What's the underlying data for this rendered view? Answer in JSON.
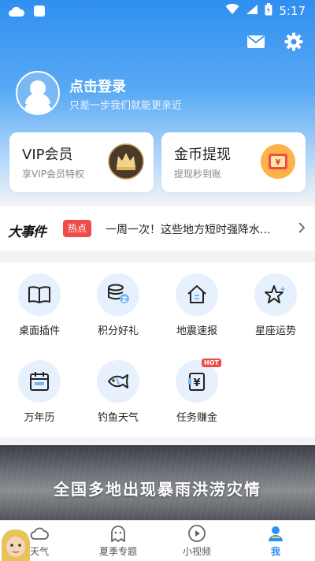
{
  "status_bar": {
    "time": "5:17"
  },
  "colors": {
    "brand": "#2f8ff0",
    "hot": "#ef4b4b",
    "icon_bg": "#e7f1fd"
  },
  "header": {
    "icons": [
      "mail-icon",
      "gear-icon"
    ]
  },
  "profile": {
    "title": "点击登录",
    "subtitle": "只差一步我们就能更亲近"
  },
  "cards": {
    "vip": {
      "title": "VIP会员",
      "subtitle": "享VIP会员特权",
      "icon": "crown-icon"
    },
    "coin": {
      "title": "金币提现",
      "subtitle": "提现秒到账",
      "icon": "red-envelope-icon"
    }
  },
  "news": {
    "logo": "大事件",
    "tag": "热点",
    "text": "一周一次！这些地方短时强降水..."
  },
  "grid": [
    {
      "label": "桌面插件",
      "icon": "book-icon"
    },
    {
      "label": "积分好礼",
      "icon": "coins-icon"
    },
    {
      "label": "地震速报",
      "icon": "house-icon"
    },
    {
      "label": "星座运势",
      "icon": "star-icon"
    },
    {
      "label": "万年历",
      "icon": "calendar-icon"
    },
    {
      "label": "钓鱼天气",
      "icon": "fish-icon"
    },
    {
      "label": "任务赚金",
      "icon": "task-coin-icon",
      "badge": "HOT"
    }
  ],
  "banner": {
    "text": "全国多地出现暴雨洪涝灾情"
  },
  "tabs": [
    {
      "label": "天气",
      "icon": "cloud-icon",
      "active": false
    },
    {
      "label": "夏季专题",
      "icon": "ghost-icon",
      "active": false
    },
    {
      "label": "小视频",
      "icon": "play-icon",
      "active": false
    },
    {
      "label": "我",
      "icon": "user-icon",
      "active": true
    }
  ]
}
